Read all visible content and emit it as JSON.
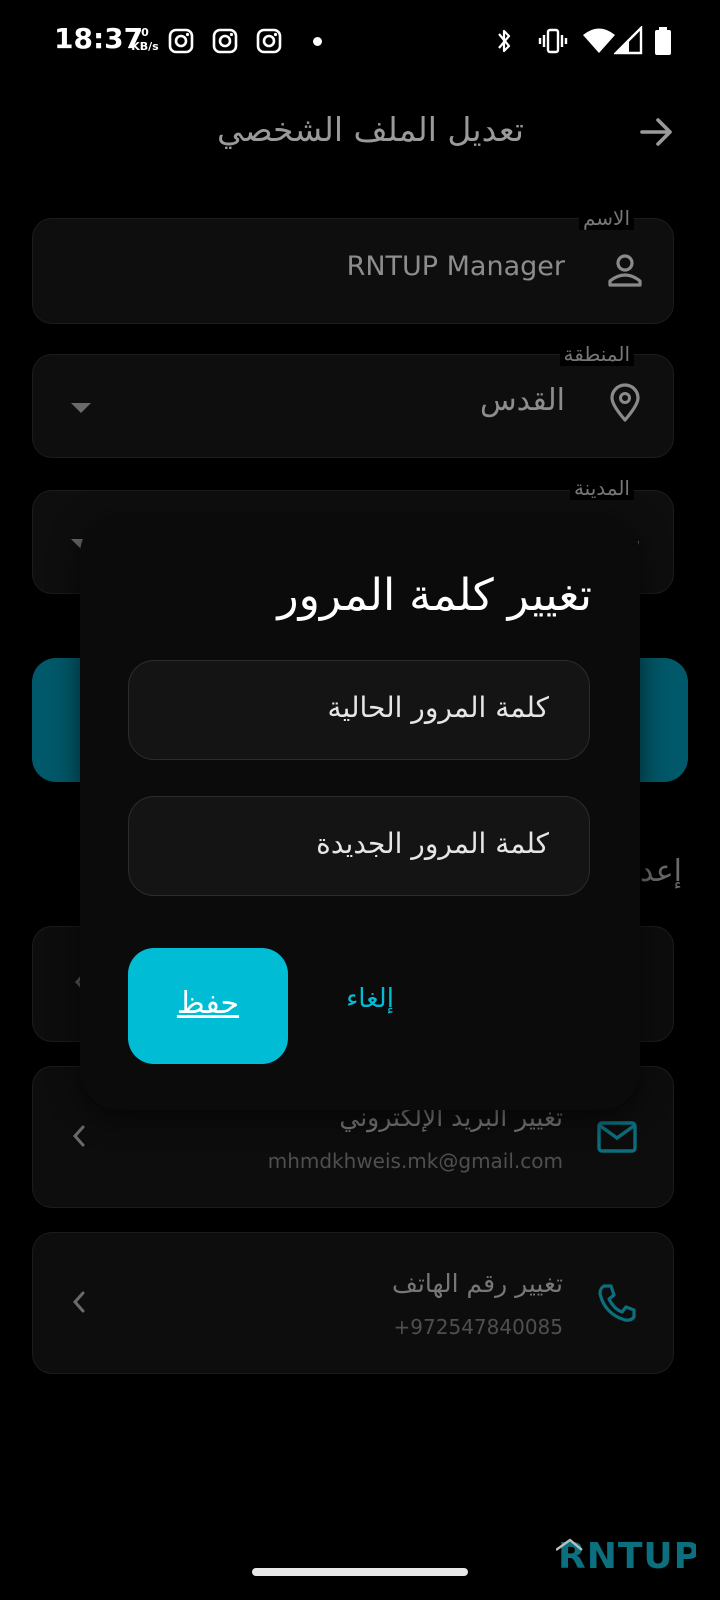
{
  "status_bar": {
    "time": "18:37",
    "net_speed_value": "0",
    "net_speed_unit": "KB/s",
    "icons": [
      "instagram-icon",
      "instagram-icon",
      "instagram-icon",
      "notification-dot",
      "bluetooth-icon",
      "vibrate-icon",
      "wifi-icon",
      "signal-icon",
      "battery-icon"
    ]
  },
  "header": {
    "title": "تعديل الملف الشخصي",
    "back_icon": "arrow-right-icon"
  },
  "form": {
    "name": {
      "label": "الاسم",
      "value": "RNTUP Manager",
      "icon": "person-icon"
    },
    "region": {
      "label": "المنطقة",
      "value": "القدس",
      "icon": "location-pin-icon"
    },
    "city": {
      "label": "المدينة",
      "icon": "city-icon"
    }
  },
  "background": {
    "section_heading_fragment": "إعد"
  },
  "settings_cards": [
    {
      "title": "تغيير البريد الإلكتروني",
      "subtitle": "mhmdkhweis.mk@gmail.com",
      "icon": "mail-icon"
    },
    {
      "title": "تغيير رقم الهاتف",
      "subtitle": "+972547840085",
      "icon": "phone-icon"
    }
  ],
  "dialog": {
    "title": "تغيير كلمة المرور",
    "current_password_placeholder": "كلمة المرور الحالية",
    "new_password_placeholder": "كلمة المرور الجديدة",
    "save_label": "حفظ",
    "cancel_label": "إلغاء"
  },
  "brand": {
    "logo_text": "RNTUP"
  },
  "colors": {
    "accent": "#00bcd4",
    "accent_dark": "#00596a",
    "background": "#000000",
    "dialog_bg": "#0b0b0b"
  }
}
